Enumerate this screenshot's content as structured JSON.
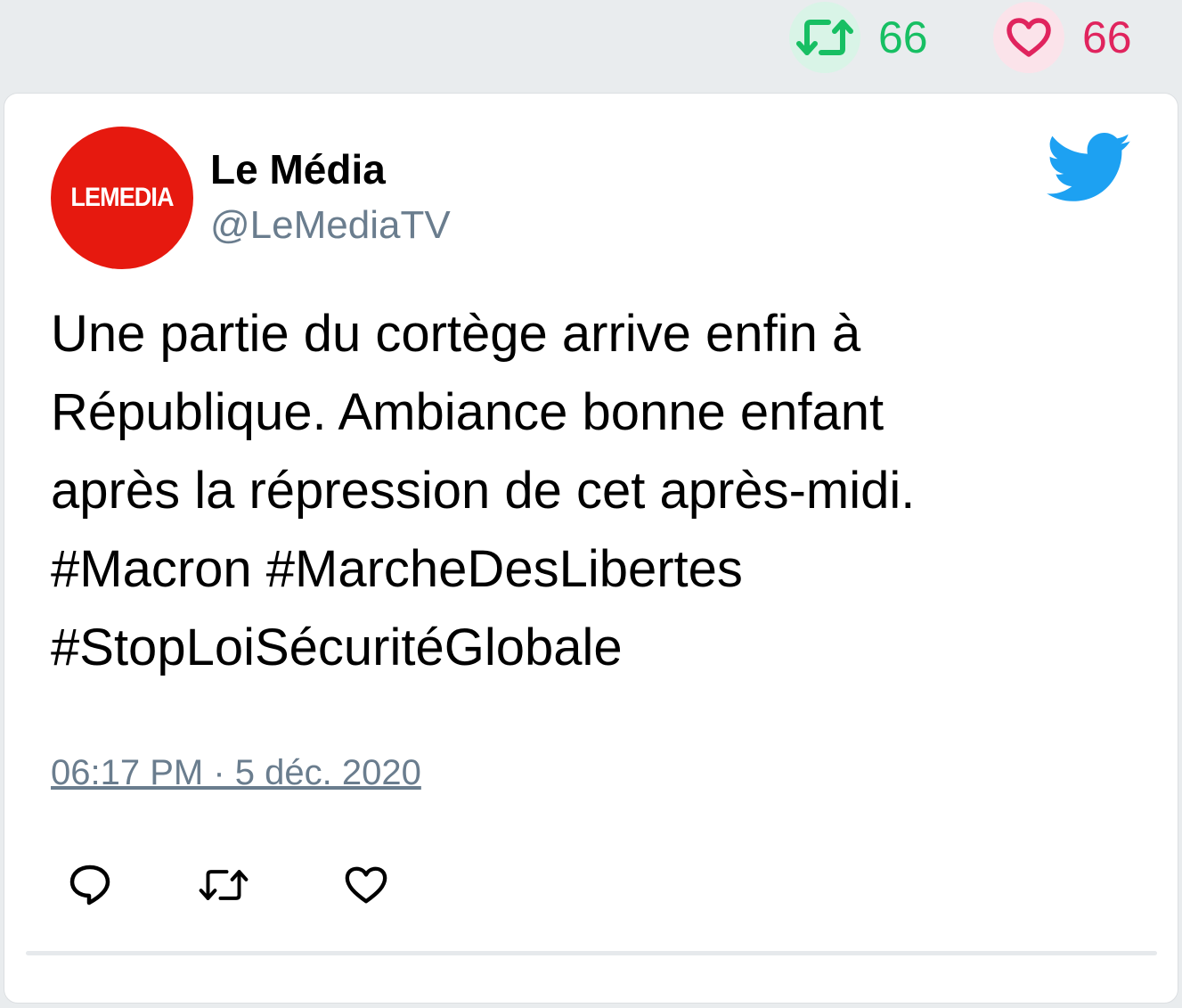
{
  "stats": {
    "retweets": "66",
    "likes": "66"
  },
  "tweet": {
    "author_name": "Le Média",
    "author_handle": "@LeMediaTV",
    "avatar_text": "LEMEDIA",
    "text": "Une partie du cortège arrive enfin à\nRépublique. Ambiance bonne enfant\naprès la répression de cet après-midi.\n#Macron #MarcheDesLibertes\n#StopLoiSécuritéGlobale",
    "timestamp": "06:17 PM · 5 déc. 2020"
  },
  "icons": {
    "retweet_stat": "retweet-icon",
    "like_stat": "heart-icon",
    "brand": "twitter-bird-icon",
    "reply": "reply-icon",
    "retweet": "retweet-icon",
    "like": "heart-icon"
  },
  "colors": {
    "retweet": "#17bf63",
    "like": "#e0245e",
    "twitter_blue": "#1da1f2",
    "avatar_red": "#e6190f",
    "muted": "#6a7d8e"
  }
}
